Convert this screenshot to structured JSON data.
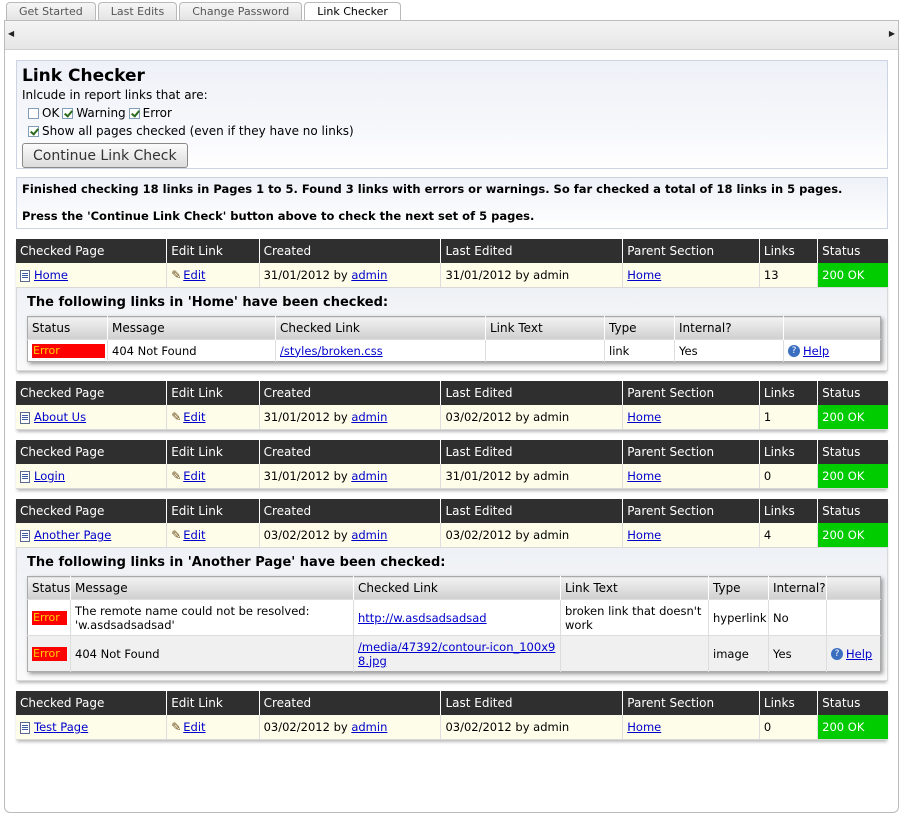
{
  "tabs": [
    {
      "label": "Get Started",
      "active": false
    },
    {
      "label": "Last Edits",
      "active": false
    },
    {
      "label": "Change Password",
      "active": false
    },
    {
      "label": "Link Checker",
      "active": true
    }
  ],
  "options": {
    "title": "Link Checker",
    "include_label": "Inlcude in report links that are:",
    "ok_label": "OK",
    "warning_label": "Warning",
    "error_label": "Error",
    "show_all_label": "Show all pages checked (even if they have no links)",
    "continue_button": "Continue Link Check"
  },
  "info": {
    "line1": "Finished checking 18 links in Pages 1 to 5. Found 3 links with errors or warnings. So far checked a total of 18 links in 5 pages.",
    "line2": "Press the 'Continue Link Check' button above to check the next set of 5 pages."
  },
  "page_headers": {
    "checked_page": "Checked Page",
    "edit_link": "Edit Link",
    "created": "Created",
    "last_edited": "Last Edited",
    "parent_section": "Parent Section",
    "links": "Links",
    "status": "Status"
  },
  "link_headers": {
    "status": "Status",
    "message": "Message",
    "checked_link": "Checked Link",
    "link_text": "Link Text",
    "type": "Type",
    "internal": "Internal?"
  },
  "common": {
    "edit": "Edit",
    "by": "by",
    "help": "Help"
  },
  "pages": [
    {
      "name": "Home",
      "created_date": "31/01/2012",
      "created_by": "admin",
      "edited_date": "31/01/2012",
      "edited_by": "admin",
      "parent": "Home",
      "links": "13",
      "status": "200 OK",
      "checked_title": "The following links in 'Home' have been checked:",
      "checked": [
        {
          "status": "Error",
          "message": "404 Not Found",
          "link": "/styles/broken.css",
          "text": "",
          "type": "link",
          "internal": "Yes",
          "help": true
        }
      ]
    },
    {
      "name": "About Us",
      "created_date": "31/01/2012",
      "created_by": "admin",
      "edited_date": "03/02/2012",
      "edited_by": "admin",
      "parent": "Home",
      "links": "1",
      "status": "200 OK"
    },
    {
      "name": "Login",
      "created_date": "31/01/2012",
      "created_by": "admin",
      "edited_date": "31/01/2012",
      "edited_by": "admin",
      "parent": "Home",
      "links": "0",
      "status": "200 OK"
    },
    {
      "name": "Another Page",
      "created_date": "03/02/2012",
      "created_by": "admin",
      "edited_date": "03/02/2012",
      "edited_by": "admin",
      "parent": "Home",
      "links": "4",
      "status": "200 OK",
      "checked_title": "The following links in 'Another Page' have been checked:",
      "checked": [
        {
          "status": "Error",
          "message": "The remote name could not be resolved: 'w.asdsadsadsad'",
          "link": "http://w.asdsadsadsad",
          "text": "broken link that doesn't work",
          "type": "hyperlink",
          "internal": "No",
          "help": false
        },
        {
          "status": "Error",
          "message": "404 Not Found",
          "link": "/media/47392/contour-icon_100x98.jpg",
          "text": "",
          "type": "image",
          "internal": "Yes",
          "help": true
        }
      ]
    },
    {
      "name": "Test Page",
      "created_date": "03/02/2012",
      "created_by": "admin",
      "edited_date": "03/02/2012",
      "edited_by": "admin",
      "parent": "Home",
      "links": "0",
      "status": "200 OK"
    }
  ],
  "colors": {
    "ok": "#00cc00",
    "error": "#ff0000",
    "header": "#2f2f2f"
  }
}
